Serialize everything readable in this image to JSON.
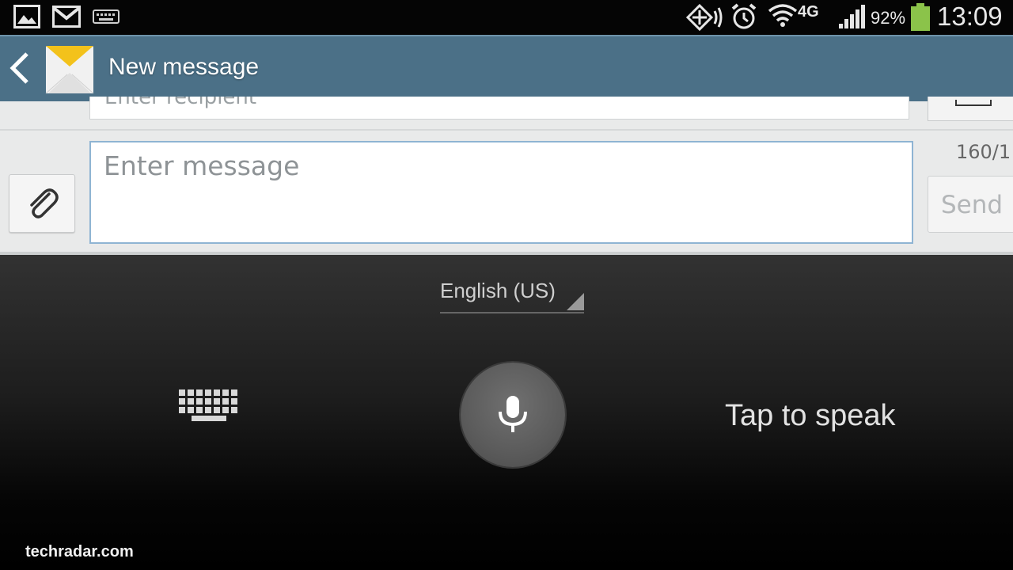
{
  "status_bar": {
    "icons": [
      "gallery-icon",
      "gmail-icon",
      "keyboard-icon",
      "nfc-icon",
      "alarm-icon",
      "wifi-icon",
      "4g-icon",
      "signal-icon",
      "battery-icon"
    ],
    "network_label": "4G",
    "battery_percent": "92%",
    "time": "13:09"
  },
  "action_bar": {
    "title": "New message",
    "background": "#4b7087"
  },
  "compose": {
    "recipient_placeholder": "Enter recipient",
    "message_placeholder": "Enter message",
    "message_value": "",
    "char_counter": "160/1",
    "send_label": "Send",
    "input_border_color": "#8fb4d3"
  },
  "voice_input": {
    "language": "English (US)",
    "prompt": "Tap to speak"
  },
  "watermark": "techradar.com"
}
